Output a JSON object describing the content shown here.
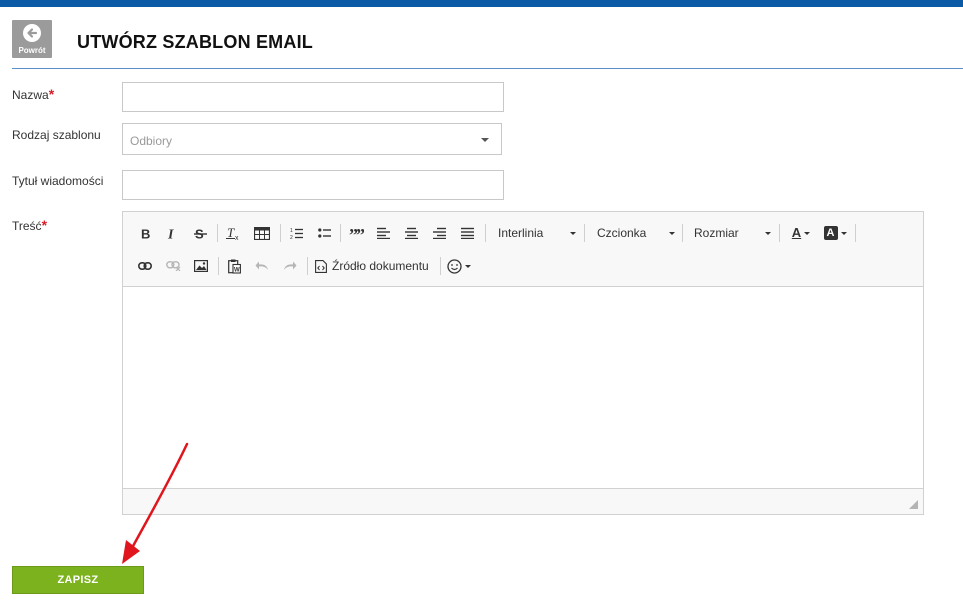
{
  "header": {
    "back_label": "Powrót",
    "title": "UTWÓRZ SZABLON EMAIL"
  },
  "form": {
    "name_label": "Nazwa",
    "required_mark": "*",
    "name_value": "",
    "template_type_label": "Rodzaj szablonu",
    "template_type_value": "Odbiory",
    "subject_label": "Tytuł wiadomości",
    "subject_value": "",
    "body_label": "Treść"
  },
  "editor": {
    "toolbar": {
      "line_height_label": "Interlinia",
      "font_label": "Czcionka",
      "size_label": "Rozmiar",
      "source_label": "Źródło dokumentu",
      "text_color_glyph": "A",
      "bg_color_glyph": "A"
    }
  },
  "actions": {
    "save_label": "ZAPISZ"
  },
  "colors": {
    "accent": "#0a5aa6",
    "save_button": "#7cb21e",
    "required": "#d9202a",
    "annotation_arrow": "#e0151d"
  }
}
